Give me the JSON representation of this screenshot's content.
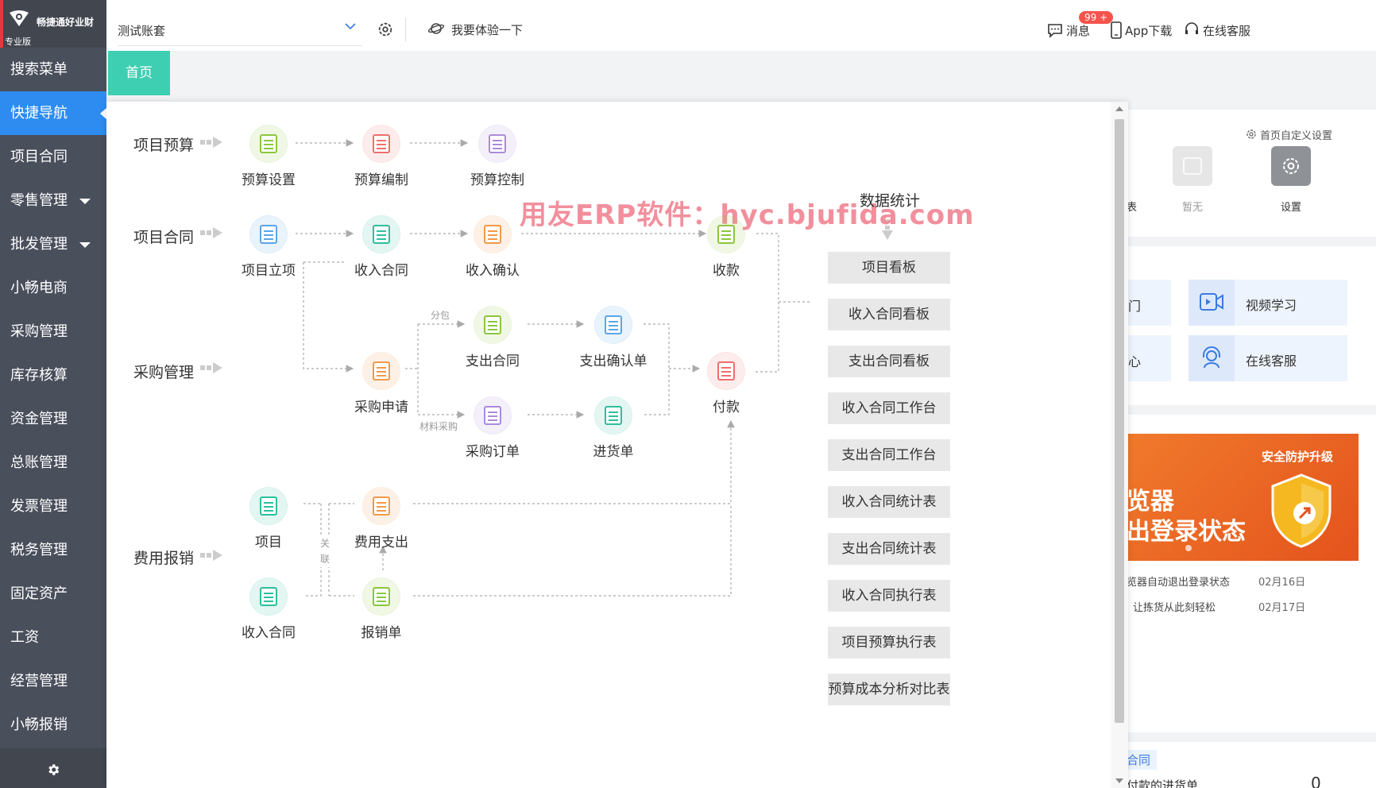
{
  "app": {
    "brand_name": "畅捷通好业财",
    "edition": "专业版"
  },
  "sidebar": {
    "items": [
      {
        "label": "搜索菜单",
        "active": false,
        "has_caret": false
      },
      {
        "label": "快捷导航",
        "active": true,
        "has_caret": false
      },
      {
        "label": "项目合同",
        "active": false,
        "has_caret": false
      },
      {
        "label": "零售管理",
        "active": false,
        "has_caret": true
      },
      {
        "label": "批发管理",
        "active": false,
        "has_caret": true
      },
      {
        "label": "小畅电商",
        "active": false,
        "has_caret": false
      },
      {
        "label": "采购管理",
        "active": false,
        "has_caret": false
      },
      {
        "label": "库存核算",
        "active": false,
        "has_caret": false
      },
      {
        "label": "资金管理",
        "active": false,
        "has_caret": false
      },
      {
        "label": "总账管理",
        "active": false,
        "has_caret": false
      },
      {
        "label": "发票管理",
        "active": false,
        "has_caret": false
      },
      {
        "label": "税务管理",
        "active": false,
        "has_caret": false
      },
      {
        "label": "固定资产",
        "active": false,
        "has_caret": false
      },
      {
        "label": "工资",
        "active": false,
        "has_caret": false
      },
      {
        "label": "经营管理",
        "active": false,
        "has_caret": false
      },
      {
        "label": "小畅报销",
        "active": false,
        "has_caret": false
      }
    ],
    "bottom_icon": "gear-icon"
  },
  "topbar": {
    "account": "测试账套",
    "try_label": "我要体验一下",
    "messages_label": "消息",
    "messages_badge": "99 +",
    "app_download_label": "App下载",
    "support_label": "在线客服"
  },
  "tabs": {
    "home": "首页"
  },
  "watermark": "用友ERP软件：hyc.bjufida.com",
  "flow": {
    "sections": {
      "budget": "项目预算",
      "contract": "项目合同",
      "purchase": "采购管理",
      "expense": "费用报销"
    },
    "nodes": {
      "budget_setting": "预算设置",
      "budget_compile": "预算编制",
      "budget_control": "预算控制",
      "project_setup": "项目立项",
      "income_contract": "收入合同",
      "income_confirm": "收入确认",
      "collection": "收款",
      "expense_contract": "支出合同",
      "expense_confirm": "支出确认单",
      "purchase_request": "采购申请",
      "payment": "付款",
      "purchase_order": "采购订单",
      "receipt_note": "进货单",
      "project": "项目",
      "fee_expense": "费用支出",
      "income_contract_2": "收入合同",
      "reimbursement": "报销单"
    },
    "tags": {
      "subcontract": "分包",
      "material_purchase": "材料采购",
      "related": "关联"
    },
    "colors": {
      "green": "#8cc63f",
      "red": "#f26d6d",
      "purple": "#a98bdc",
      "blue": "#5aa6e8",
      "orange": "#f2994a",
      "teal": "#2dbf9c"
    }
  },
  "stats": {
    "title": "数据统计",
    "buttons": [
      "项目看板",
      "收入合同看板",
      "支出合同看板",
      "收入合同工作台",
      "支出合同工作台",
      "收入合同统计表",
      "支出合同统计表",
      "收入合同执行表",
      "项目预算执行表",
      "预算成本分析对比表"
    ]
  },
  "right_panel": {
    "custom_settings": "首页自定义设置",
    "partial_label_1": "表",
    "none_label": "暂无",
    "settings_label": "设置",
    "partial_tile_1": "门",
    "video_label": "视频学习",
    "partial_tile_2": "心",
    "support_label": "在线客服",
    "banner_tag": "安全防护升级",
    "banner_line1": "览器",
    "banner_line2": "出登录状态",
    "news": [
      {
        "title": "览器自动退出登录状态",
        "date": "02月16日"
      },
      {
        "title": "让拣货从此刻轻松",
        "date": "02月17日"
      }
    ],
    "contract_tag": "合同",
    "pending_label": "付款的进货单",
    "pending_count": "0"
  }
}
